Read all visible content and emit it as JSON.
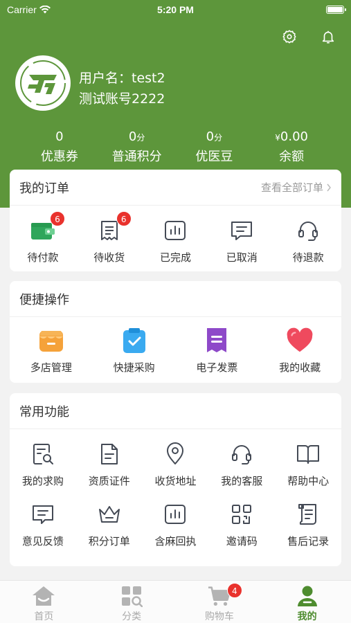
{
  "status_bar": {
    "carrier": "Carrier",
    "time": "5:20 PM"
  },
  "icons": {
    "settings": "gear-icon",
    "notifications": "bell-icon"
  },
  "user": {
    "name": "用户名：test2",
    "account": "测试账号2222"
  },
  "stats": [
    {
      "value": "0",
      "unit": "",
      "prefix": "",
      "label": "优惠券"
    },
    {
      "value": "0",
      "unit": "分",
      "prefix": "",
      "label": "普通积分"
    },
    {
      "value": "0",
      "unit": "分",
      "prefix": "",
      "label": "优医豆"
    },
    {
      "value": "0.00",
      "unit": "",
      "prefix": "¥",
      "label": "余额"
    }
  ],
  "orders": {
    "title": "我的订单",
    "more": "查看全部订单",
    "items": [
      {
        "label": "待付款",
        "badge": "6",
        "icon": "wallet-icon"
      },
      {
        "label": "待收货",
        "badge": "6",
        "icon": "receipt-icon"
      },
      {
        "label": "已完成",
        "badge": "",
        "icon": "chart-icon"
      },
      {
        "label": "已取消",
        "badge": "",
        "icon": "message-icon"
      },
      {
        "label": "待退款",
        "badge": "",
        "icon": "headset-icon"
      }
    ]
  },
  "quick": {
    "title": "便捷操作",
    "items": [
      {
        "label": "多店管理",
        "icon": "store-icon"
      },
      {
        "label": "快捷采购",
        "icon": "clipboard-check-icon"
      },
      {
        "label": "电子发票",
        "icon": "invoice-icon"
      },
      {
        "label": "我的收藏",
        "icon": "heart-icon"
      }
    ]
  },
  "common": {
    "title": "常用功能",
    "items": [
      {
        "label": "我的求购",
        "icon": "search-document-icon"
      },
      {
        "label": "资质证件",
        "icon": "document-icon"
      },
      {
        "label": "收货地址",
        "icon": "location-pin-icon"
      },
      {
        "label": "我的客服",
        "icon": "headset-icon"
      },
      {
        "label": "帮助中心",
        "icon": "book-icon"
      },
      {
        "label": "意见反馈",
        "icon": "feedback-icon"
      },
      {
        "label": "积分订单",
        "icon": "crown-icon"
      },
      {
        "label": "含麻回执",
        "icon": "chart-icon"
      },
      {
        "label": "邀请码",
        "icon": "qr-code-icon"
      },
      {
        "label": "售后记录",
        "icon": "scroll-icon"
      }
    ]
  },
  "tabbar": [
    {
      "label": "首页",
      "icon": "home-icon",
      "active": false,
      "badge": ""
    },
    {
      "label": "分类",
      "icon": "category-icon",
      "active": false,
      "badge": ""
    },
    {
      "label": "购物车",
      "icon": "cart-icon",
      "active": false,
      "badge": "4"
    },
    {
      "label": "我的",
      "icon": "person-icon",
      "active": true,
      "badge": ""
    }
  ],
  "colors": {
    "brand": "#5d963b",
    "badge": "#e9322d",
    "active_tab": "#4e8c2f"
  }
}
